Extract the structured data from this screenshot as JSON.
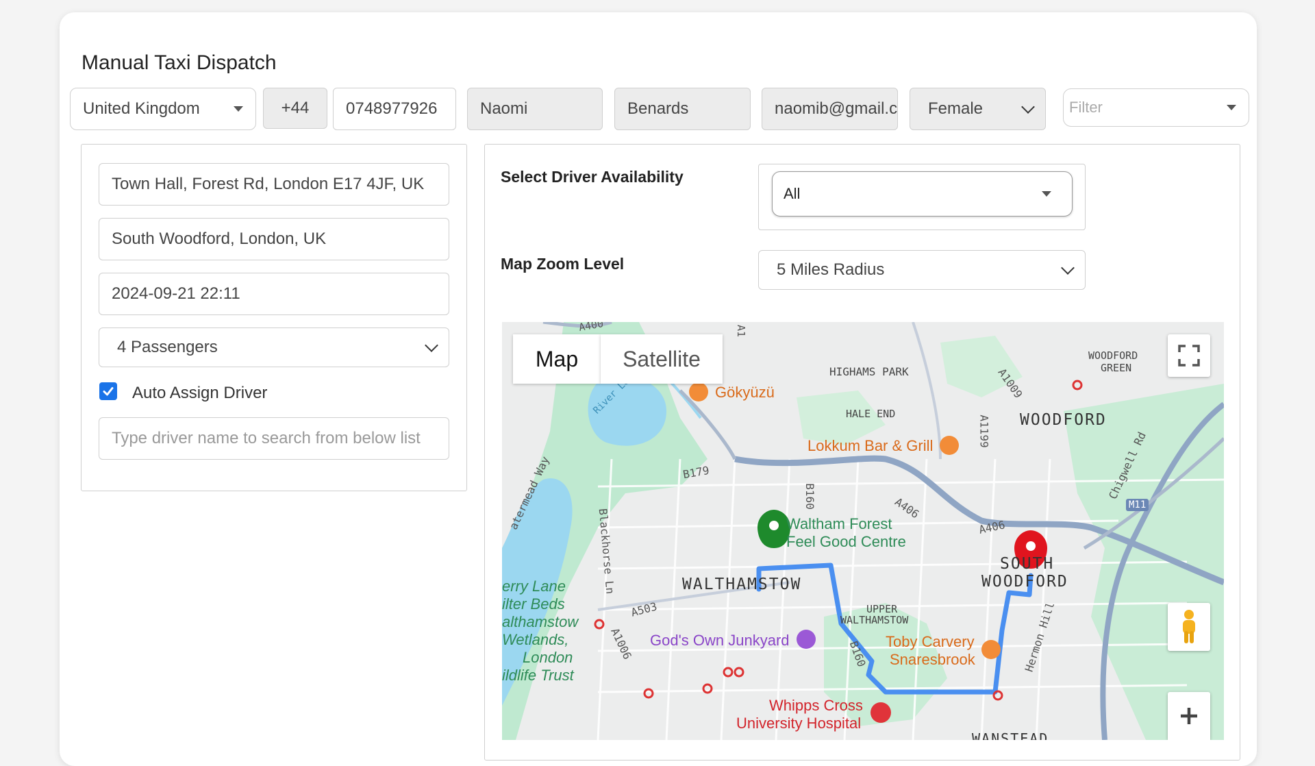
{
  "page": {
    "title": "Manual Taxi Dispatch"
  },
  "top_row": {
    "country": "United Kingdom",
    "dial_code": "+44",
    "phone": "0748977926",
    "first_name": "Naomi",
    "last_name": "Benards",
    "email": "naomib@gmail.c",
    "gender": "Female",
    "filter_placeholder": "Filter"
  },
  "left_panel": {
    "pickup": "Town Hall, Forest Rd, London E17 4JF, UK",
    "dropoff": "South Woodford, London, UK",
    "datetime": "2024-09-21 22:11",
    "passengers": "4 Passengers",
    "auto_assign_label": "Auto Assign Driver",
    "driver_search_placeholder": "Type driver name to search from below list"
  },
  "right_panel": {
    "availability_label": "Select Driver Availability",
    "availability_value": "All",
    "zoom_label": "Map Zoom Level",
    "zoom_value": "5 Miles Radius"
  },
  "map": {
    "tab_map": "Map",
    "tab_satellite": "Satellite",
    "areas": {
      "highams_park": "HIGHAMS PARK",
      "woodford_green_1": "WOODFORD",
      "woodford_green_2": "GREEN",
      "hale_end": "HALE END",
      "woodford": "WOODFORD",
      "walthamstow": "WALTHAMSTOW",
      "upper_walthamstow_1": "UPPER",
      "upper_walthamstow_2": "WALTHAMSTOW",
      "south_woodford_1": "SOUTH",
      "south_woodford_2": "WOODFORD",
      "wanstead": "WANSTEAD"
    },
    "roads": {
      "a1009": "A1009",
      "a1199": "A1199",
      "b179": "B179",
      "b160": "B160",
      "b160b": "B160",
      "a406": "A406",
      "a406b": "A406",
      "a503": "A503",
      "a1006": "A1006",
      "m11": "M11",
      "a1": "A1",
      "a400": "A400",
      "blackhorse": "Blackhorse Ln",
      "chigwell": "Chigwell Rd",
      "hermon": "Hermon Hill",
      "watermead": "atermead Way",
      "river": "River Le"
    },
    "pois": {
      "gokyuzu": "Gökyüzü",
      "lokkum": "Lokkum Bar & Grill",
      "waltham_forest_1": "Waltham Forest",
      "waltham_forest_2": "Feel Good Centre",
      "gods_own": "God's Own Junkyard",
      "toby_1": "Toby Carvery",
      "toby_2": "Snaresbrook",
      "whipps_1": "Whipps Cross",
      "whipps_2": "University Hospital",
      "ferry_1": "erry Lane",
      "ferry_2": "ilter Beds",
      "ferry_3": "althamstow",
      "ferry_4": "Wetlands,",
      "ferry_5": "London",
      "ferry_6": "ildlife Trust"
    },
    "colors": {
      "route": "#4a8ff0",
      "pickup_marker": "#1e8a2c",
      "dropoff_marker": "#e0141e",
      "water": "#9bd7f0",
      "park": "#bfe9d0"
    }
  },
  "colors": {
    "accent": "#1a73e8",
    "field_grey": "#ececec"
  }
}
